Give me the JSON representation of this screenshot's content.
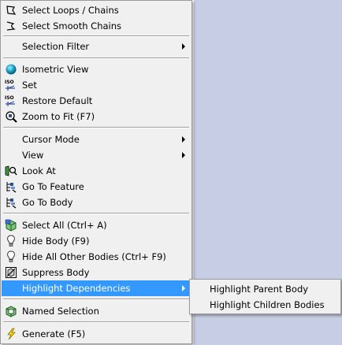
{
  "context_menu": {
    "items": [
      {
        "label": "Select Loops / Chains",
        "icon": "select-loops-icon"
      },
      {
        "label": "Select Smooth Chains",
        "icon": "select-smooth-chains-icon"
      },
      {
        "label": "Selection Filter",
        "has_submenu": true
      },
      {
        "label": "Isometric View",
        "icon": "isometric-view-icon"
      },
      {
        "label": "Set",
        "icon": "iso-set-icon"
      },
      {
        "label": "Restore Default",
        "icon": "iso-restore-icon"
      },
      {
        "label": "Zoom to Fit (F7)",
        "icon": "zoom-to-fit-icon"
      },
      {
        "label": "Cursor Mode",
        "has_submenu": true
      },
      {
        "label": "View",
        "has_submenu": true
      },
      {
        "label": "Look At",
        "icon": "look-at-icon"
      },
      {
        "label": "Go To Feature",
        "icon": "go-to-feature-icon"
      },
      {
        "label": "Go To Body",
        "icon": "go-to-body-icon"
      },
      {
        "label": "Select All (Ctrl+ A)",
        "icon": "select-all-icon"
      },
      {
        "label": "Hide Body (F9)",
        "icon": "hide-body-icon"
      },
      {
        "label": "Hide All Other Bodies (Ctrl+ F9)",
        "icon": "hide-other-bodies-icon"
      },
      {
        "label": "Suppress Body",
        "icon": "suppress-body-icon"
      },
      {
        "label": "Highlight Dependencies",
        "has_submenu": true,
        "highlighted": true
      },
      {
        "label": "Named Selection",
        "icon": "named-selection-icon"
      },
      {
        "label": "Generate (F5)",
        "icon": "generate-icon"
      }
    ]
  },
  "submenu": {
    "items": [
      {
        "label": "Highlight Parent Body"
      },
      {
        "label": "Highlight Children Bodies"
      }
    ]
  },
  "colors": {
    "menu_background": "#f0f0f0",
    "highlight": "#3399ff",
    "viewport_background": "#c7cde4"
  }
}
